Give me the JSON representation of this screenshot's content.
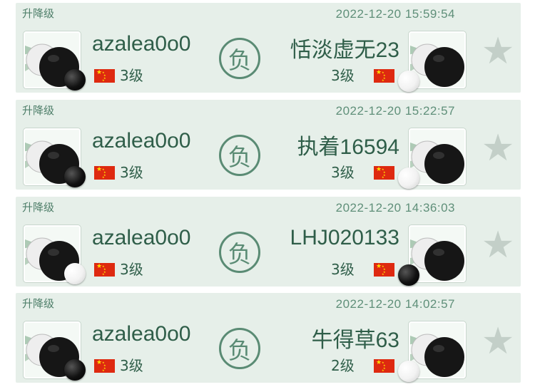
{
  "games": [
    {
      "mode": "升降级",
      "time": "2022-12-20 15:59:54",
      "left": {
        "name": "azalea0o0",
        "rank": "3级",
        "stone": "black"
      },
      "right": {
        "name": "恬淡虚无23",
        "rank": "3级",
        "stone": "white"
      },
      "result": "负"
    },
    {
      "mode": "升降级",
      "time": "2022-12-20 15:22:57",
      "left": {
        "name": "azalea0o0",
        "rank": "3级",
        "stone": "black"
      },
      "right": {
        "name": "执着16594",
        "rank": "3级",
        "stone": "white"
      },
      "result": "负"
    },
    {
      "mode": "升降级",
      "time": "2022-12-20 14:36:03",
      "left": {
        "name": "azalea0o0",
        "rank": "3级",
        "stone": "white"
      },
      "right": {
        "name": "LHJ020133",
        "rank": "3级",
        "stone": "black"
      },
      "result": "负"
    },
    {
      "mode": "升降级",
      "time": "2022-12-20 14:02:57",
      "left": {
        "name": "azalea0o0",
        "rank": "3级",
        "stone": "black"
      },
      "right": {
        "name": "牛得草63",
        "rank": "2级",
        "stone": "white"
      },
      "result": "负"
    }
  ],
  "icons": {
    "favorite": "star-icon",
    "flag": "china-flag-icon",
    "result_badge": "loss-badge-icon"
  },
  "colors": {
    "card_bg": "#e6efe9",
    "text_green": "#2f5e49",
    "badge_green": "#5a8b74",
    "flag_red": "#de2910"
  }
}
